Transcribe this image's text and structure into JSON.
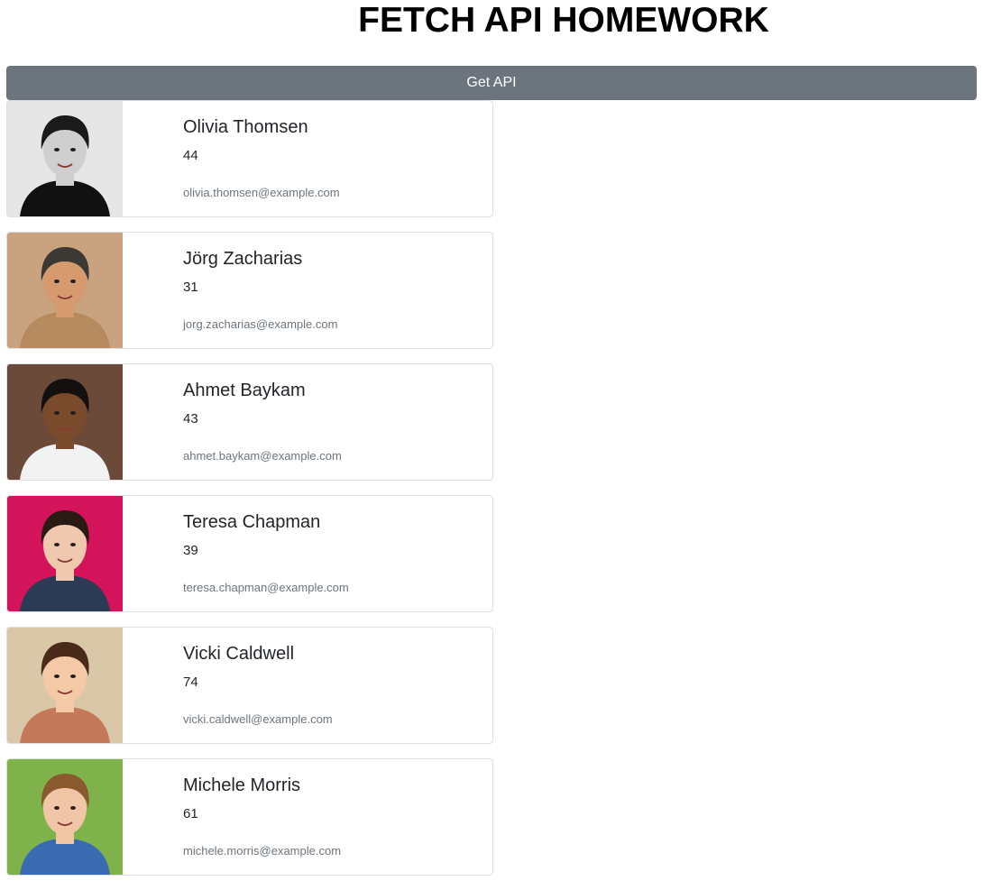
{
  "header": {
    "title": "FETCH API HOMEWORK"
  },
  "toolbar": {
    "get_api_label": "Get API",
    "button_color": "#6c757d"
  },
  "users": [
    {
      "name": "Olivia Thomsen",
      "age": "44",
      "email": "olivia.thomsen@example.com",
      "photo": {
        "bg": "#e6e6e6",
        "skin": "#cfcfcf",
        "hair": "#1a1a1a",
        "shirt": "#111111"
      }
    },
    {
      "name": "Jörg Zacharias",
      "age": "31",
      "email": "jorg.zacharias@example.com",
      "photo": {
        "bg": "#c9a27f",
        "skin": "#d59a6e",
        "hair": "#3c3833",
        "shirt": "#b58a5e"
      }
    },
    {
      "name": "Ahmet Baykam",
      "age": "43",
      "email": "ahmet.baykam@example.com",
      "photo": {
        "bg": "#6b4a3a",
        "skin": "#7a4a2c",
        "hair": "#151010",
        "shirt": "#f2f2f2"
      }
    },
    {
      "name": "Teresa Chapman",
      "age": "39",
      "email": "teresa.chapman@example.com",
      "photo": {
        "bg": "#d4145a",
        "skin": "#f0c8b0",
        "hair": "#2a1a14",
        "shirt": "#2b3a55"
      }
    },
    {
      "name": "Vicki Caldwell",
      "age": "74",
      "email": "vicki.caldwell@example.com",
      "photo": {
        "bg": "#d9c7a8",
        "skin": "#f3c9a8",
        "hair": "#4a2a1a",
        "shirt": "#c47a5a"
      }
    },
    {
      "name": "Michele Morris",
      "age": "61",
      "email": "michele.morris@example.com",
      "photo": {
        "bg": "#7fb24a",
        "skin": "#f1c6a6",
        "hair": "#8a5a2e",
        "shirt": "#3a6ab0"
      }
    }
  ]
}
